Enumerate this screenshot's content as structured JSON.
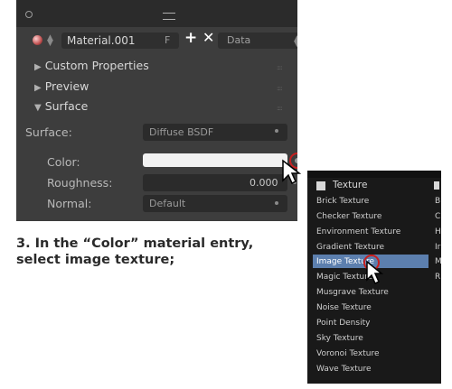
{
  "panel": {
    "material_name": "Material.001",
    "fake_user_label": "F",
    "new_icon": "+",
    "unlink_icon": "✕",
    "data_dropdown": "Data",
    "sections": [
      {
        "label": "Custom Properties",
        "state": "▶"
      },
      {
        "label": "Preview",
        "state": "▶"
      },
      {
        "label": "Surface",
        "state": "▼"
      }
    ],
    "surface_label": "Surface:",
    "surface_value": "Diffuse BSDF",
    "color_label": "Color:",
    "roughness_label": "Roughness:",
    "roughness_value": "0.000",
    "normal_label": "Normal:",
    "normal_value": "Default"
  },
  "caption": {
    "line1": "3. In the “Color” material entry,",
    "line2": "select image texture;"
  },
  "menu": {
    "header": "Texture",
    "items": [
      "Brick Texture",
      "Checker Texture",
      "Environment Texture",
      "Gradient Texture",
      "Image Texture",
      "Magic Texture",
      "Musgrave Texture",
      "Noise Texture",
      "Point Density",
      "Sky Texture",
      "Voronoi Texture",
      "Wave Texture"
    ],
    "selected_index": 4,
    "second_column_letters": [
      "B",
      "C",
      "H",
      "Ir",
      "M",
      "R"
    ]
  },
  "colors": {
    "panel_bg": "#3d3d3d",
    "menu_bg": "#191919",
    "highlight": "#5c7fae",
    "socket_ring": "#c71f1f"
  },
  "icons": [
    "material-sphere-icon",
    "hamburger-icon",
    "texture-icon",
    "mouse-cursor-icon"
  ]
}
